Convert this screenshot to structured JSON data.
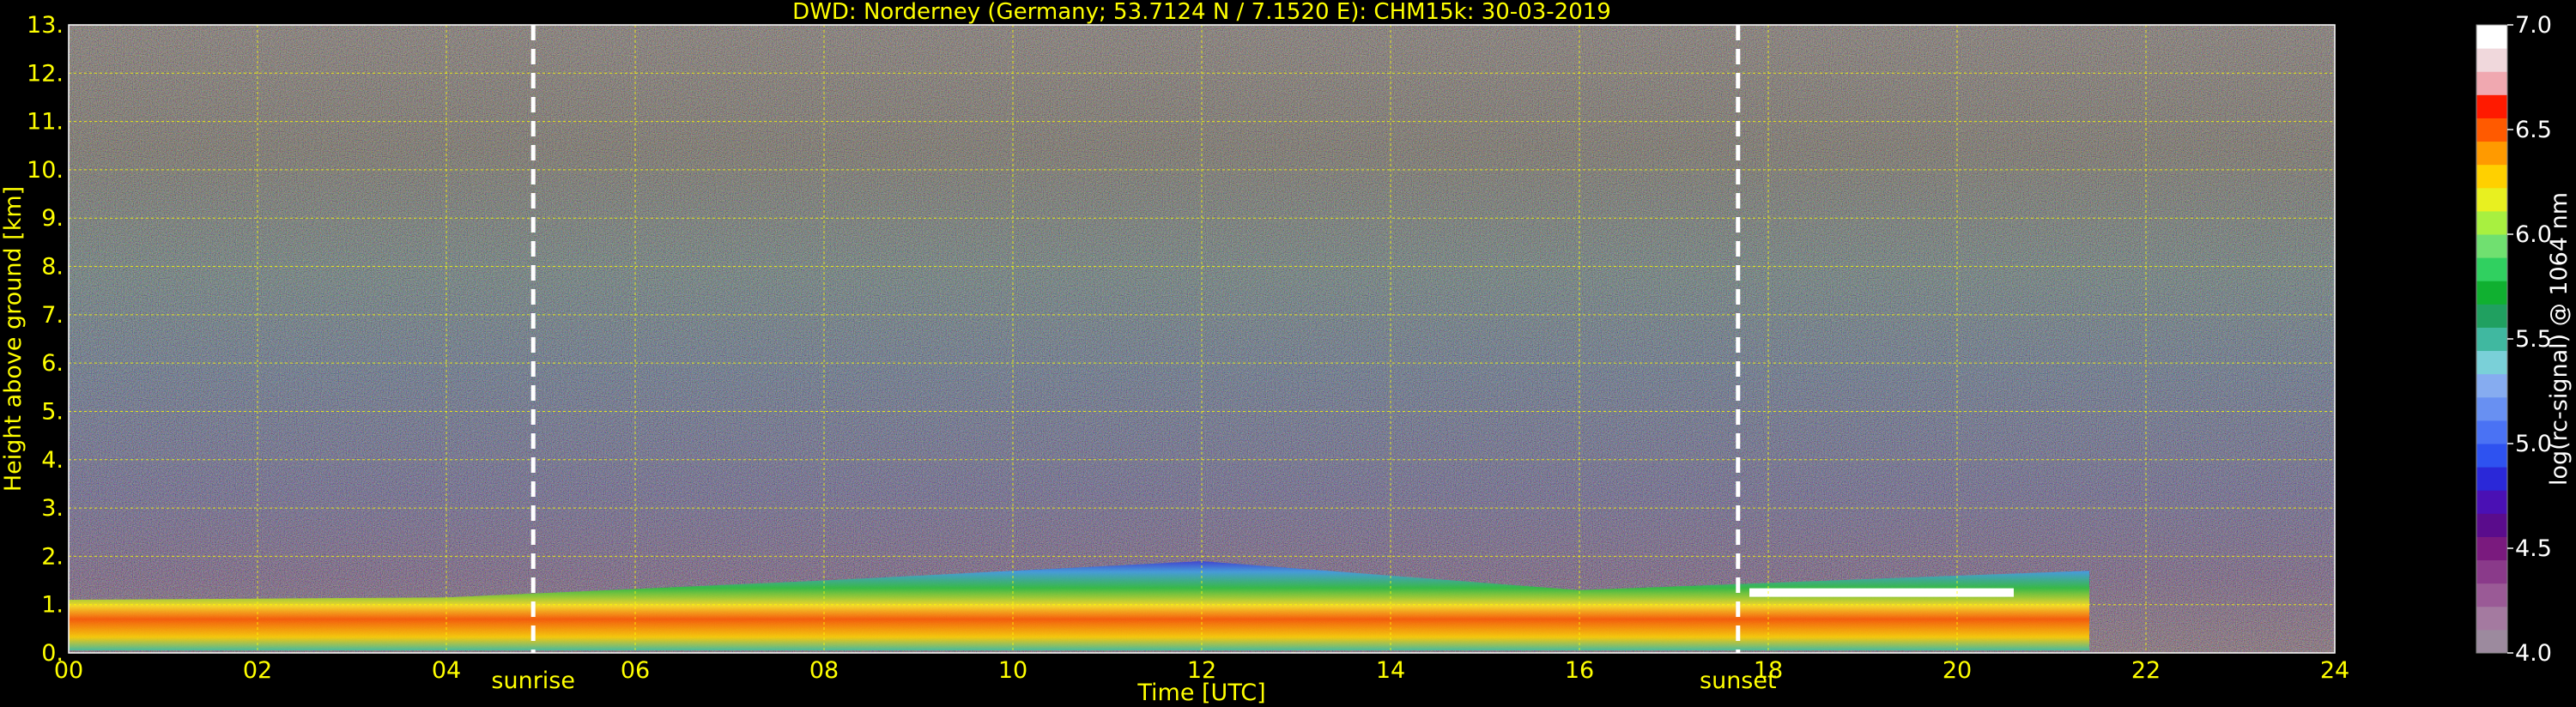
{
  "chart_data": {
    "type": "heatmap",
    "title": "DWD: Norderney (Germany; 53.7124 N / 7.1520 E):    CHM15k: 30-03-2019",
    "xlabel": "Time [UTC]",
    "ylabel": "Height above ground [km]",
    "xlim": [
      0,
      24
    ],
    "ylim": [
      0,
      13
    ],
    "x_ticks": [
      "00",
      "02",
      "04",
      "06",
      "08",
      "10",
      "12",
      "14",
      "16",
      "18",
      "20",
      "22",
      "24"
    ],
    "y_ticks": [
      "0.",
      "1.",
      "2.",
      "3.",
      "4.",
      "5.",
      "6.",
      "7.",
      "8.",
      "9.",
      "10.",
      "11.",
      "12.",
      "13."
    ],
    "grid": true,
    "colorbar": {
      "label": "log(rc-signal) @ 1064 nm",
      "range": [
        4.0,
        7.0
      ],
      "ticks": [
        "4.0",
        "4.5",
        "5.0",
        "5.5",
        "6.0",
        "6.5",
        "7.0"
      ],
      "colors": [
        "#9c8a9e",
        "#a47aa0",
        "#9a5a96",
        "#8a3a8a",
        "#7a1a7e",
        "#5a0c8c",
        "#4a10b4",
        "#2a28d8",
        "#2e52f0",
        "#4a72f4",
        "#6890f2",
        "#86acf0",
        "#7ad0d8",
        "#40b8a0",
        "#20a060",
        "#10b030",
        "#30d060",
        "#70e070",
        "#a8f040",
        "#e8f020",
        "#ffd000",
        "#ff9a00",
        "#ff5a00",
        "#ff1a00",
        "#f0a8b0",
        "#f0d8dc",
        "#ffffff"
      ]
    },
    "markers": [
      {
        "label": "sunrise",
        "x": 4.92
      },
      {
        "label": "sunset",
        "x": 17.68
      }
    ],
    "layers": [
      {
        "name": "boundary-layer",
        "x_start": 0,
        "x_end": 21.4,
        "bottom_km": 0.05,
        "top_km_at": [
          [
            0,
            1.1
          ],
          [
            4,
            1.15
          ],
          [
            8,
            1.5
          ],
          [
            12,
            1.9
          ],
          [
            16,
            1.3
          ],
          [
            20,
            1.6
          ],
          [
            21.4,
            1.7
          ]
        ]
      },
      {
        "name": "cloud-base",
        "x_start": 17.8,
        "x_end": 20.6,
        "height_km": 1.25
      }
    ]
  }
}
